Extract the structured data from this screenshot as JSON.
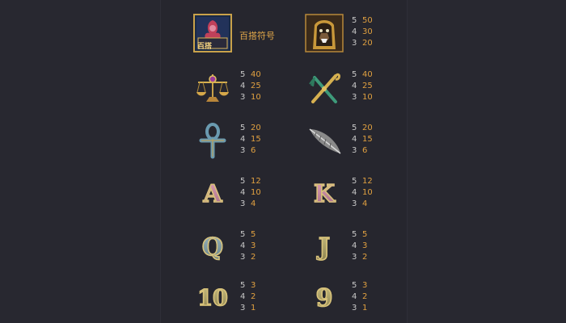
{
  "paytable": {
    "rows": [
      {
        "left": {
          "icon": "wild-symbol-icon",
          "label": "百搭符号",
          "badge": "百搭",
          "pays": []
        },
        "right": {
          "icon": "pharaoh-mask-icon",
          "pays": [
            {
              "count": "5",
              "value": "50"
            },
            {
              "count": "4",
              "value": "30"
            },
            {
              "count": "3",
              "value": "20"
            }
          ]
        }
      },
      {
        "left": {
          "icon": "scales-icon",
          "pays": [
            {
              "count": "5",
              "value": "40"
            },
            {
              "count": "4",
              "value": "25"
            },
            {
              "count": "3",
              "value": "10"
            }
          ]
        },
        "right": {
          "icon": "crook-flail-icon",
          "pays": [
            {
              "count": "5",
              "value": "40"
            },
            {
              "count": "4",
              "value": "25"
            },
            {
              "count": "3",
              "value": "10"
            }
          ]
        }
      },
      {
        "left": {
          "icon": "ankh-icon",
          "pays": [
            {
              "count": "5",
              "value": "20"
            },
            {
              "count": "4",
              "value": "15"
            },
            {
              "count": "3",
              "value": "6"
            }
          ]
        },
        "right": {
          "icon": "feather-icon",
          "pays": [
            {
              "count": "5",
              "value": "20"
            },
            {
              "count": "4",
              "value": "15"
            },
            {
              "count": "3",
              "value": "6"
            }
          ]
        }
      },
      {
        "left": {
          "icon": "letter-a-icon",
          "letter": "A",
          "pays": [
            {
              "count": "5",
              "value": "12"
            },
            {
              "count": "4",
              "value": "10"
            },
            {
              "count": "3",
              "value": "4"
            }
          ]
        },
        "right": {
          "icon": "letter-k-icon",
          "letter": "K",
          "pays": [
            {
              "count": "5",
              "value": "12"
            },
            {
              "count": "4",
              "value": "10"
            },
            {
              "count": "3",
              "value": "4"
            }
          ]
        }
      },
      {
        "left": {
          "icon": "letter-q-icon",
          "letter": "Q",
          "pays": [
            {
              "count": "5",
              "value": "5"
            },
            {
              "count": "4",
              "value": "3"
            },
            {
              "count": "3",
              "value": "2"
            }
          ]
        },
        "right": {
          "icon": "letter-j-icon",
          "letter": "J",
          "pays": [
            {
              "count": "5",
              "value": "5"
            },
            {
              "count": "4",
              "value": "3"
            },
            {
              "count": "3",
              "value": "2"
            }
          ]
        }
      },
      {
        "left": {
          "icon": "number-10-icon",
          "letter": "10",
          "pays": [
            {
              "count": "5",
              "value": "3"
            },
            {
              "count": "4",
              "value": "2"
            },
            {
              "count": "3",
              "value": "1"
            }
          ]
        },
        "right": {
          "icon": "number-9-icon",
          "letter": "9",
          "pays": [
            {
              "count": "5",
              "value": "3"
            },
            {
              "count": "4",
              "value": "2"
            },
            {
              "count": "3",
              "value": "1"
            }
          ]
        }
      }
    ]
  }
}
